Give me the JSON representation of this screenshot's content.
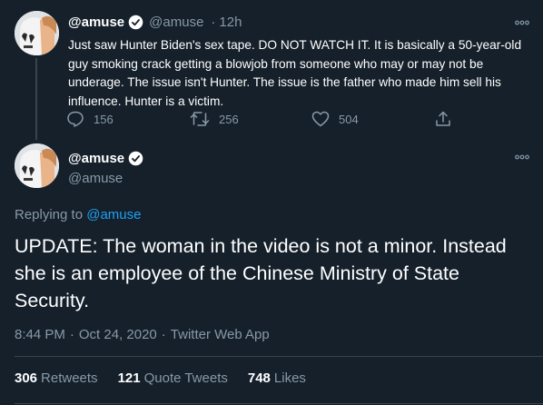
{
  "parent_tweet": {
    "name": "@amuse",
    "handle": "@amuse",
    "separator": "·",
    "time": "12h",
    "text": "Just saw Hunter Biden's sex tape. DO NOT WATCH IT. It is basically a 50-year-old guy smoking crack getting a blowjob from someone who may or may not be underage. The issue isn't Hunter. The issue is the father who made him sell his influence. Hunter is a victim.",
    "reply_count": "156",
    "retweet_count": "256",
    "like_count": "504"
  },
  "main_tweet": {
    "name": "@amuse",
    "handle": "@amuse",
    "replying_prefix": "Replying to",
    "replying_to": "@amuse",
    "text": "UPDATE: The woman in the video is not a minor. Instead she is an employee of the Chinese Ministry of State Security.",
    "time": "8:44 PM",
    "date": "Oct 24, 2020",
    "source": "Twitter Web App",
    "meta_separator": "·",
    "stats": {
      "retweets_count": "306",
      "retweets_label": "Retweets",
      "quotes_count": "121",
      "quotes_label": "Quote Tweets",
      "likes_count": "748",
      "likes_label": "Likes"
    }
  },
  "icons": {
    "verified": "verified-badge-icon",
    "more": "more-options-icon",
    "reply": "reply-icon",
    "retweet": "retweet-icon",
    "like": "like-icon",
    "share": "share-icon"
  },
  "colors": {
    "background": "#15202b",
    "text": "#ffffff",
    "muted": "#8899a6",
    "accent": "#1da1f2",
    "divider": "#38444d"
  }
}
